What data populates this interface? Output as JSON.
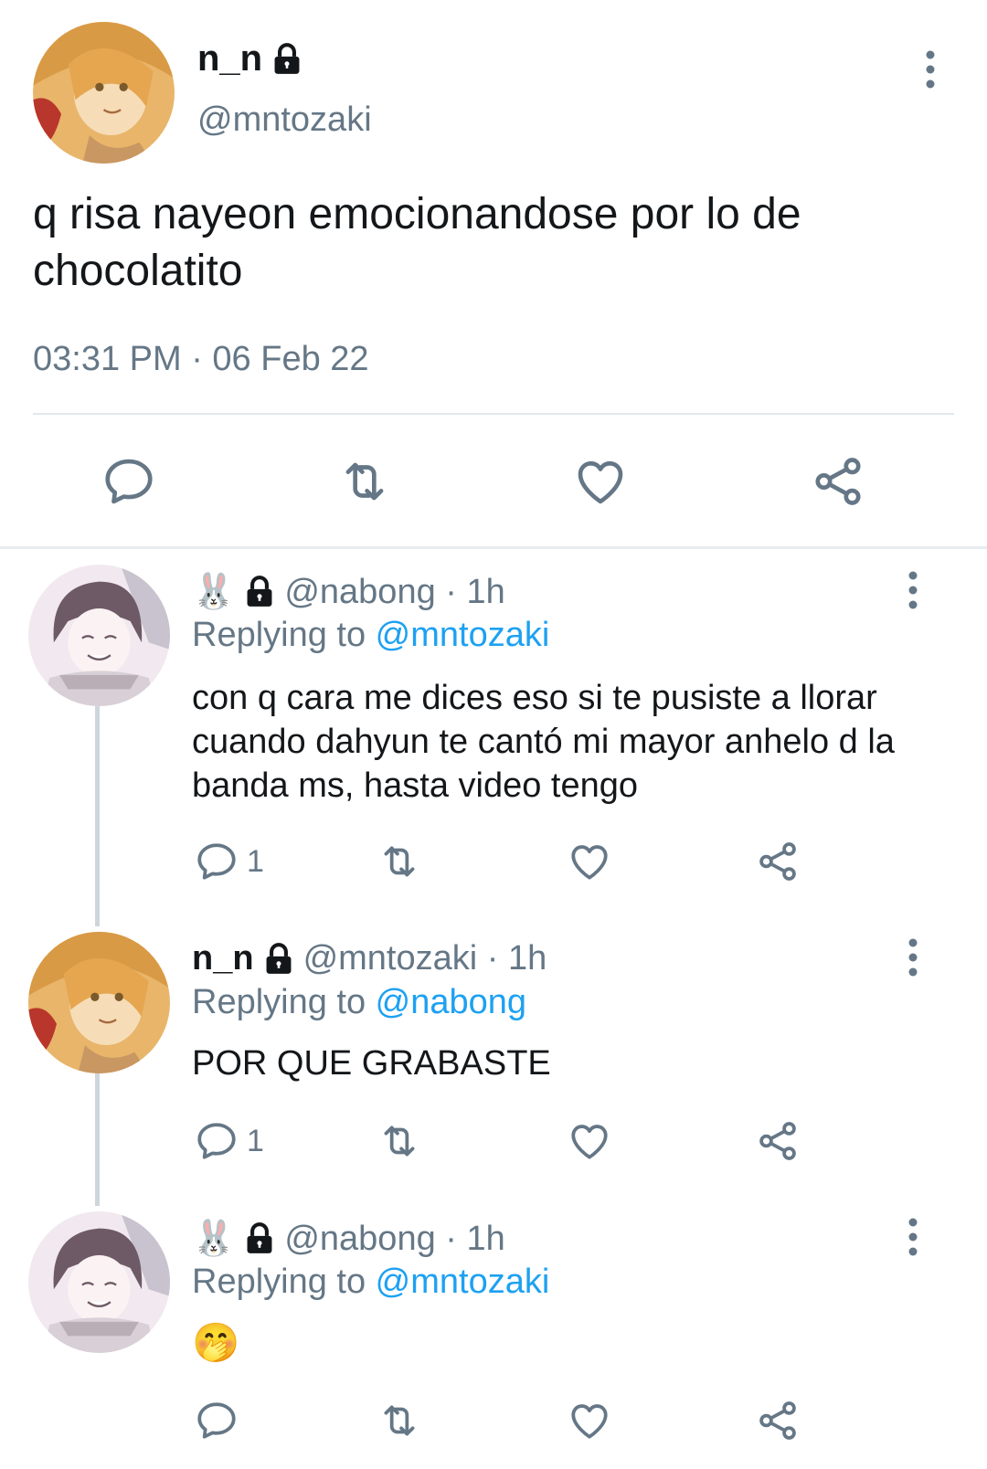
{
  "colors": {
    "text": "#14171a",
    "muted": "#657786",
    "link": "#1da1f2",
    "divider": "#e1e8ed",
    "icon": "#657786"
  },
  "main": {
    "display_name": "n_n",
    "handle": "@mntozaki",
    "text": "q risa nayeon emocionandose por lo de chocolatito",
    "timestamp": "03:31 PM · 06 Feb 22",
    "icons": [
      "lock-icon",
      "more-icon",
      "reply-icon",
      "retweet-icon",
      "like-icon",
      "share-icon"
    ]
  },
  "replies": [
    {
      "display_name": "",
      "emoji": "🐰",
      "handle_time": "@nabong · 1h",
      "replying_prefix": "Replying to ",
      "replying_to": "@mntozaki",
      "text": "con q cara me dices eso si te pusiste a llorar cuando dahyun te cantó mi mayor anhelo d la banda ms, hasta video tengo",
      "reply_count": "1"
    },
    {
      "display_name": "n_n",
      "emoji": "",
      "handle_time": "@mntozaki · 1h",
      "replying_prefix": "Replying to ",
      "replying_to": "@nabong",
      "text": "POR QUE GRABASTE",
      "reply_count": "1"
    },
    {
      "display_name": "",
      "emoji": "🐰",
      "handle_time": "@nabong · 1h",
      "replying_prefix": "Replying to ",
      "replying_to": "@mntozaki",
      "text": "🤭",
      "reply_count": ""
    }
  ]
}
